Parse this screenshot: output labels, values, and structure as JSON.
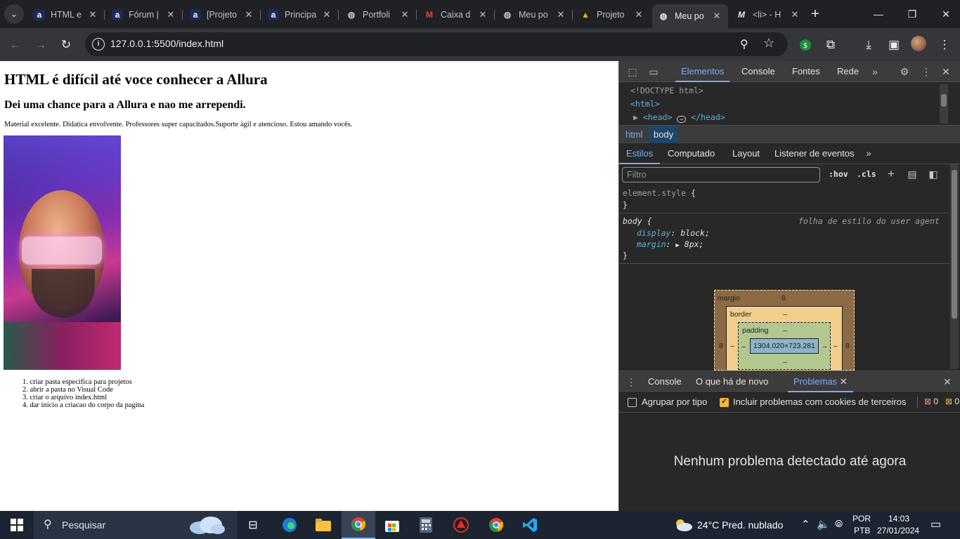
{
  "browser": {
    "tabs": [
      {
        "title": "HTML e",
        "favicon": "alura-icon"
      },
      {
        "title": "Fórum |",
        "favicon": "alura-icon"
      },
      {
        "title": "[Projeto",
        "favicon": "alura-icon"
      },
      {
        "title": "Principa",
        "favicon": "alura-icon"
      },
      {
        "title": "Portfoli",
        "favicon": "globe-icon"
      },
      {
        "title": "Caixa d",
        "favicon": "gmail-icon"
      },
      {
        "title": "Meu po",
        "favicon": "globe-icon"
      },
      {
        "title": "Projeto",
        "favicon": "vercel-icon"
      },
      {
        "title": "Meu po",
        "favicon": "globe-icon"
      },
      {
        "title": "<li> - H",
        "favicon": "mdn-icon"
      }
    ],
    "active_tab_index": 8,
    "url": "127.0.0.1:5500/index.html"
  },
  "page": {
    "h1": "HTML é difícil até voce conhecer a Allura",
    "h2": "Dei uma chance para a Allura e nao me arrependi.",
    "paragraph": "Material excelente. Didatica envolvente. Professores super capacitados.Suporte ágil e atencioso. Estou amando vocês.",
    "list": [
      "criar pasta especifica para projetos",
      "abrir a pasta no Visual Code",
      "criar o arquivo index.html",
      "dar inicio a criacao do corpo da pagina"
    ],
    "list_markers": [
      "1.",
      "2.",
      "3.",
      "4."
    ]
  },
  "devtools": {
    "tabs": [
      "Elementos",
      "Console",
      "Fontes",
      "Rede"
    ],
    "dom": {
      "doctype": "<!DOCTYPE html>",
      "html": "<html>",
      "head_open": "<head>",
      "head_close": "</head>"
    },
    "breadcrumbs": [
      "html",
      "body"
    ],
    "styles_tabs": [
      "Estilos",
      "Computado",
      "Layout",
      "Listener de eventos"
    ],
    "filter_placeholder": "Filtro",
    "hov": ":hov",
    "cls": ".cls",
    "element_style": "element.style",
    "brace_open": "{",
    "brace_close": "}",
    "body_selector": "body",
    "ua_label": "folha de estilo do user agent",
    "display_prop": "display",
    "display_val": "block;",
    "margin_prop": "margin",
    "margin_val": "8px;",
    "box_model": {
      "margin_label": "margin",
      "margin_top": "8",
      "margin_left": "8",
      "margin_right": "8",
      "border_label": "border",
      "border_top": "–",
      "border_left": "–",
      "border_right": "–",
      "padding_label": "padding",
      "padding_top": "–",
      "padding_left": "–",
      "padding_right": "–",
      "padding_bottom": "–",
      "content": "1304.020×723.281"
    },
    "drawer_tabs": [
      "Console",
      "O que há de novo",
      "Problemas"
    ],
    "group_by_type": "Agrupar por tipo",
    "include_third_party": "Incluir problemas com cookies de terceiros",
    "error_count": "0",
    "warning_count": "0",
    "no_problems": "Nenhum problema detectado até agora"
  },
  "taskbar": {
    "search_placeholder": "Pesquisar",
    "weather": "24°C  Pred. nublado",
    "lang_top": "POR",
    "lang_bottom": "PTB",
    "time": "14:03",
    "date": "27/01/2024"
  },
  "colors": {
    "accent": "#7cacf8",
    "devtools_bg": "#282828",
    "browser_bg": "#202124",
    "taskbar_bg": "#1c2331"
  }
}
